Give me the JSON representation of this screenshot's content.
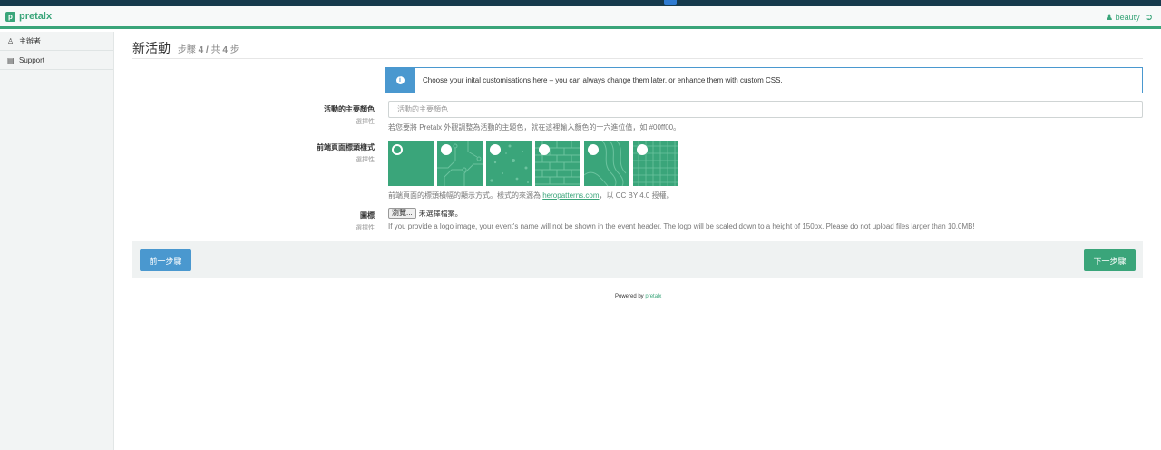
{
  "brand": {
    "name": "pretalx",
    "logo_letter": "p"
  },
  "user": {
    "name": "beauty",
    "icon": "user-icon",
    "logout_icon": "logout-icon"
  },
  "sidebar": {
    "items": [
      {
        "label": "主辦者",
        "icon": "organizer-icon"
      },
      {
        "label": "Support",
        "icon": "support-icon"
      }
    ]
  },
  "page": {
    "title": "新活動",
    "step_prefix": "步驟",
    "step_current": "4",
    "step_sep": "/",
    "step_total_prefix": "共",
    "step_total": "4",
    "step_suffix": "步"
  },
  "alert": {
    "icon": "info-icon",
    "text": "Choose your inital customisations here – you can always change them later, or enhance them with custom CSS."
  },
  "primary_color": {
    "label": "活動的主要顏色",
    "optional": "選擇性",
    "placeholder": "活動的主要顏色",
    "help": "若您要將 Pretalx 外觀調整為活動的主題色，就在這裡輸入顏色的十六進位值，如 #00ff00。"
  },
  "header_pattern": {
    "label": "前端頁面標頭樣式",
    "optional": "選擇性",
    "options": [
      "plain",
      "circuit",
      "dots",
      "brick",
      "topography",
      "grid"
    ],
    "selected_index": 0,
    "color": "#3aa57a",
    "help_prefix": "前端頁面的標頭橫幅的顯示方式。樣式的來源為",
    "help_link": "heropatterns.com",
    "help_suffix": "，以 CC BY 4.0 授權。"
  },
  "logo": {
    "label": "圖標",
    "optional": "選擇性",
    "browse_label": "瀏覽...",
    "file_status": "未選擇檔案。",
    "help": "If you provide a logo image, your event's name will not be shown in the event header. The logo will be scaled down to a height of 150px. Please do not upload files larger than 10.0MB!"
  },
  "actions": {
    "prev_label": "前一步驟",
    "next_label": "下一步驟"
  },
  "footer": {
    "powered_prefix": "Powered by",
    "powered_link": "pretalx"
  },
  "colors": {
    "accent": "#3aa57a",
    "info": "#4a98cf",
    "topbar": "#163a4d"
  }
}
